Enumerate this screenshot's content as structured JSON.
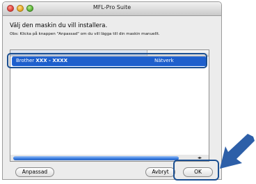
{
  "window": {
    "title": "MFL-Pro Suite"
  },
  "heading": "Välj den maskin du vill installera.",
  "subtext": "Obs: Klicka på knappen \"Anpassad\" om du vill lägga till din maskin manuellt.",
  "list": {
    "rows": [
      {
        "name_prefix": "Brother ",
        "name_model": "XXX - XXXX",
        "type": "Nätverk"
      }
    ]
  },
  "scrollbar": {
    "arrows": "◂▸"
  },
  "buttons": {
    "custom": "Anpassad",
    "cancel": "Avbryt",
    "ok": "OK"
  },
  "colors": {
    "selection": "#1e5fcc",
    "highlight": "#1b4f91"
  },
  "icons": {
    "pointer": "arrow-pointer-icon"
  }
}
